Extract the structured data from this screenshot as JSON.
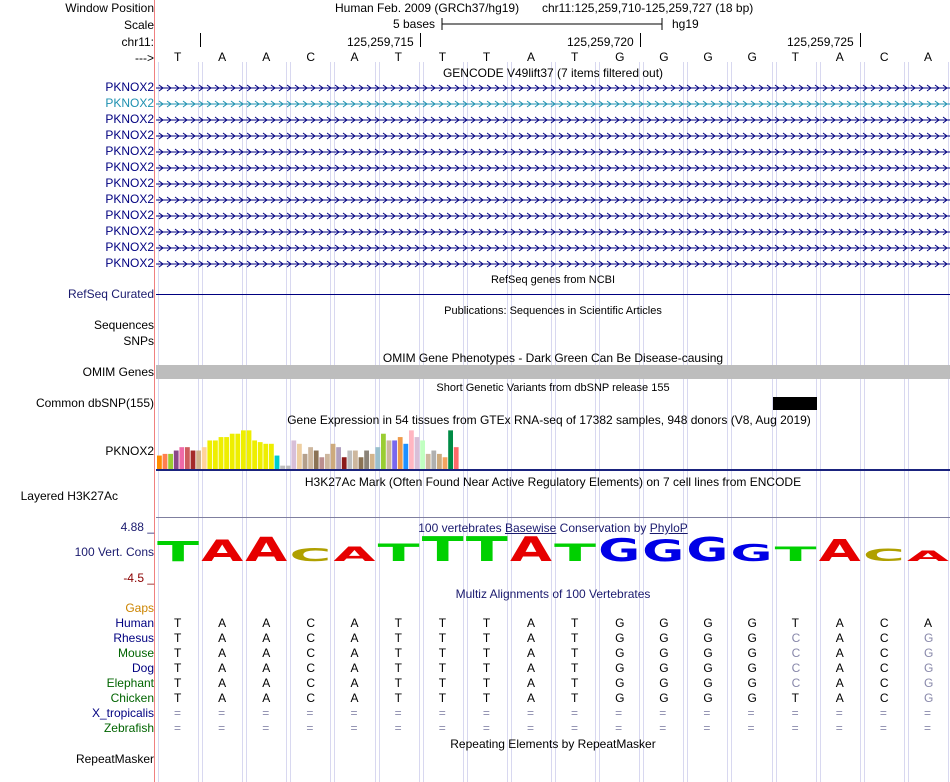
{
  "header": {
    "window_position_label": "Window Position",
    "scale_label": "Scale",
    "chrom_label": "chr11:",
    "strand_label": "--->",
    "assembly": "Human Feb. 2009 (GRCh37/hg19)",
    "position": "chr11:125,259,710-125,259,727 (18 bp)",
    "scale_text": "5 bases",
    "db": "hg19",
    "ticks": [
      "125,259,715",
      "125,259,720",
      "125,259,725"
    ]
  },
  "sequence": [
    "T",
    "A",
    "A",
    "C",
    "A",
    "T",
    "T",
    "T",
    "A",
    "T",
    "G",
    "G",
    "G",
    "G",
    "T",
    "A",
    "C",
    "A"
  ],
  "gencode": {
    "title": "GENCODE V49lift37 (7 items filtered out)",
    "genes": [
      "PKNOX2",
      "PKNOX2",
      "PKNOX2",
      "PKNOX2",
      "PKNOX2",
      "PKNOX2",
      "PKNOX2",
      "PKNOX2",
      "PKNOX2",
      "PKNOX2",
      "PKNOX2",
      "PKNOX2"
    ],
    "highlight_color": "#1e90b0",
    "color": "#000080"
  },
  "refseq": {
    "title": "RefSeq genes from NCBI",
    "label": "RefSeq Curated"
  },
  "publications": {
    "title": "Publications: Sequences in Scientific Articles",
    "label1": "Sequences",
    "label2": "SNPs"
  },
  "omim": {
    "title": "OMIM Gene Phenotypes - Dark Green Can Be Disease-causing",
    "label": "OMIM Genes",
    "color": "#006400"
  },
  "dbsnp": {
    "title": "Short Genetic Variants from dbSNP release 155",
    "label": "Common dbSNP(155)"
  },
  "gtex": {
    "title": "Gene Expression in 54 tissues from GTEx RNA-seq of 17382 samples, 948 donors (V8, Aug 2019)",
    "label": "PKNOX2",
    "bars": [
      {
        "v": 0.32,
        "c": "#ff8c00"
      },
      {
        "v": 0.36,
        "c": "#ff7f50"
      },
      {
        "v": 0.36,
        "c": "#9acd32"
      },
      {
        "v": 0.44,
        "c": "#8b4789"
      },
      {
        "v": 0.52,
        "c": "#ee6aa7"
      },
      {
        "v": 0.52,
        "c": "#cd5c5c"
      },
      {
        "v": 0.44,
        "c": "#a52a2a"
      },
      {
        "v": 0.44,
        "c": "#d2b48c"
      },
      {
        "v": 0.52,
        "c": "#ffd39b"
      },
      {
        "v": 0.68,
        "c": "#eeee00"
      },
      {
        "v": 0.68,
        "c": "#eeee00"
      },
      {
        "v": 0.76,
        "c": "#eeee00"
      },
      {
        "v": 0.76,
        "c": "#eeee00"
      },
      {
        "v": 0.84,
        "c": "#eeee00"
      },
      {
        "v": 0.84,
        "c": "#eeee00"
      },
      {
        "v": 0.92,
        "c": "#eeee00"
      },
      {
        "v": 0.92,
        "c": "#eeee00"
      },
      {
        "v": 0.68,
        "c": "#eeee00"
      },
      {
        "v": 0.64,
        "c": "#eeee00"
      },
      {
        "v": 0.6,
        "c": "#eeee00"
      },
      {
        "v": 0.6,
        "c": "#eeee00"
      },
      {
        "v": 0.32,
        "c": "#00cdcd"
      },
      {
        "v": 0.08,
        "c": "#bebebe"
      },
      {
        "v": 0.08,
        "c": "#bebebe"
      },
      {
        "v": 0.68,
        "c": "#d8bfd8"
      },
      {
        "v": 0.6,
        "c": "#eecfa1"
      },
      {
        "v": 0.36,
        "c": "#b4a08c"
      },
      {
        "v": 0.52,
        "c": "#cdb79e"
      },
      {
        "v": 0.44,
        "c": "#8b7355"
      },
      {
        "v": 0.28,
        "c": "#bc8f8f"
      },
      {
        "v": 0.36,
        "c": "#cdb79e"
      },
      {
        "v": 0.6,
        "c": "#cdaa7d"
      },
      {
        "v": 0.52,
        "c": "#b0a0c0"
      },
      {
        "v": 0.28,
        "c": "#8b1a1a"
      },
      {
        "v": 0.44,
        "c": "#bebebe"
      },
      {
        "v": 0.44,
        "c": "#cdb79e"
      },
      {
        "v": 0.28,
        "c": "#8b7355"
      },
      {
        "v": 0.44,
        "c": "#8b8378"
      },
      {
        "v": 0.36,
        "c": "#d2b48c"
      },
      {
        "v": 0.52,
        "c": "#9ac0cd"
      },
      {
        "v": 0.84,
        "c": "#9acd32"
      },
      {
        "v": 0.68,
        "c": "#cdb79e"
      },
      {
        "v": 0.68,
        "c": "#7a67ee"
      },
      {
        "v": 0.76,
        "c": "#ee9a49"
      },
      {
        "v": 0.6,
        "c": "#1e90ff"
      },
      {
        "v": 0.92,
        "c": "#ffb6c1"
      },
      {
        "v": 0.76,
        "c": "#d8bfd8"
      },
      {
        "v": 0.68,
        "c": "#c1ffc1"
      },
      {
        "v": 0.36,
        "c": "#cdb79e"
      },
      {
        "v": 0.44,
        "c": "#b0b0b0"
      },
      {
        "v": 0.36,
        "c": "#cdaa7d"
      },
      {
        "v": 0.28,
        "c": "#f4a460"
      },
      {
        "v": 0.92,
        "c": "#008b45"
      },
      {
        "v": 0.52,
        "c": "#ff6a6a"
      }
    ]
  },
  "h3k27ac": {
    "title": "H3K27Ac Mark (Often Found Near Active Regulatory Elements) on 7 cell lines from ENCODE",
    "label": "Layered H3K27Ac"
  },
  "conservation": {
    "title_pre": "100 vertebrates ",
    "title_link": "Basewise",
    "title_post": " Conservation by ",
    "title_link2": "PhyloP",
    "label": "100 Vert. Cons",
    "max": "4.88 _",
    "min": "-4.5 _",
    "heights": [
      0.55,
      0.6,
      0.72,
      0.25,
      0.3,
      0.45,
      0.75,
      0.75,
      0.75,
      0.45,
      0.65,
      0.6,
      0.72,
      0.4,
      0.3,
      0.62,
      0.2,
      0.12
    ],
    "colors": {
      "A": "#e60000",
      "C": "#b0a000",
      "G": "#0000e6",
      "T": "#00d000"
    }
  },
  "multiz": {
    "title": "Multiz Alignments of 100 Vertebrates",
    "gaps_label": "Gaps",
    "species": [
      {
        "name": "Human",
        "color": "#000080",
        "seq": [
          "T",
          "A",
          "A",
          "C",
          "A",
          "T",
          "T",
          "T",
          "A",
          "T",
          "G",
          "G",
          "G",
          "G",
          "T",
          "A",
          "C",
          "A"
        ]
      },
      {
        "name": "Rhesus",
        "color": "#000080",
        "seq": [
          "T",
          "A",
          "A",
          "C",
          "A",
          "T",
          "T",
          "T",
          "A",
          "T",
          "G",
          "G",
          "G",
          "G",
          "C",
          "A",
          "C",
          "G"
        ]
      },
      {
        "name": "Mouse",
        "color": "#006400",
        "seq": [
          "T",
          "A",
          "A",
          "C",
          "A",
          "T",
          "T",
          "T",
          "A",
          "T",
          "G",
          "G",
          "G",
          "G",
          "C",
          "A",
          "C",
          "G"
        ]
      },
      {
        "name": "Dog",
        "color": "#000080",
        "seq": [
          "T",
          "A",
          "A",
          "C",
          "A",
          "T",
          "T",
          "T",
          "A",
          "T",
          "G",
          "G",
          "G",
          "G",
          "C",
          "A",
          "C",
          "G"
        ]
      },
      {
        "name": "Elephant",
        "color": "#006400",
        "seq": [
          "T",
          "A",
          "A",
          "C",
          "A",
          "T",
          "T",
          "T",
          "A",
          "T",
          "G",
          "G",
          "G",
          "G",
          "C",
          "A",
          "C",
          "G"
        ]
      },
      {
        "name": "Chicken",
        "color": "#006400",
        "seq": [
          "T",
          "A",
          "A",
          "C",
          "A",
          "T",
          "T",
          "T",
          "A",
          "T",
          "G",
          "G",
          "G",
          "G",
          "T",
          "A",
          "C",
          "G"
        ]
      },
      {
        "name": "X_tropicalis",
        "color": "#000080",
        "seq": [
          "=",
          "=",
          "=",
          "=",
          "=",
          "=",
          "=",
          "=",
          "=",
          "=",
          "=",
          "=",
          "=",
          "=",
          "=",
          "=",
          "=",
          "="
        ]
      },
      {
        "name": "Zebrafish",
        "color": "#006400",
        "seq": [
          "=",
          "=",
          "=",
          "=",
          "=",
          "=",
          "=",
          "=",
          "=",
          "=",
          "=",
          "=",
          "=",
          "=",
          "=",
          "=",
          "=",
          "="
        ]
      }
    ]
  },
  "repeatmasker": {
    "title": "Repeating Elements by RepeatMasker",
    "label": "RepeatMasker"
  }
}
